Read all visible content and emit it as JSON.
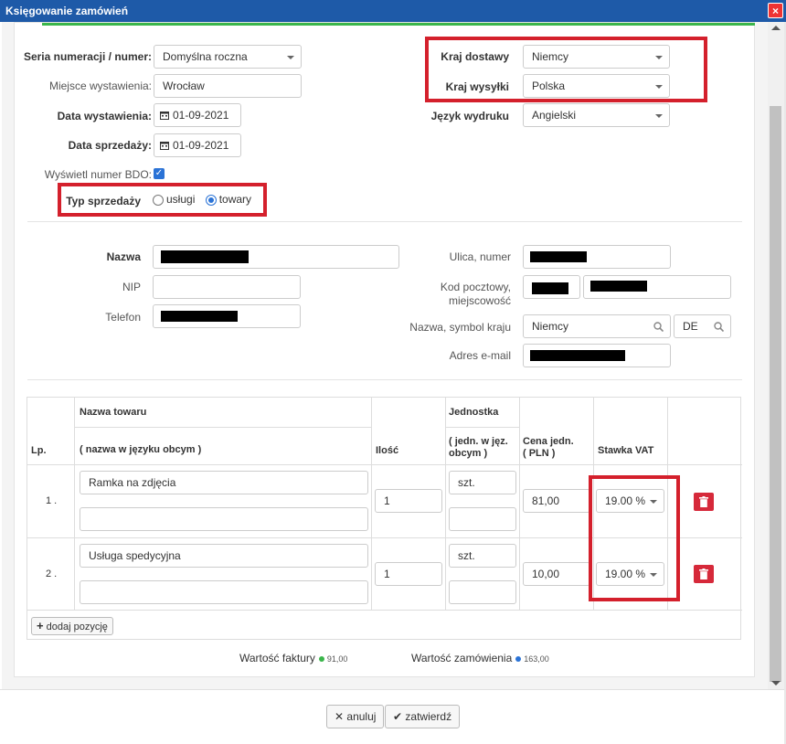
{
  "window": {
    "title": "Księgowanie zamówień",
    "close": "×"
  },
  "header": {
    "series_label": "Seria numeracji / numer:",
    "series_value": "Domyślna roczna",
    "place_label": "Miejsce wystawienia:",
    "place_value": "Wrocław",
    "issue_date_label": "Data wystawienia:",
    "issue_date_value": "01-09-2021",
    "sale_date_label": "Data sprzedaży:",
    "sale_date_value": "01-09-2021",
    "bdo_label": "Wyświetl numer BDO:",
    "bdo_checked": true,
    "sale_type_label": "Typ sprzedaży",
    "sale_type_options": [
      "usługi",
      "towary"
    ],
    "sale_type_selected": "towary",
    "delivery_country_label": "Kraj dostawy",
    "delivery_country_value": "Niemcy",
    "shipping_country_label": "Kraj wysyłki",
    "shipping_country_value": "Polska",
    "print_language_label": "Język wydruku",
    "print_language_value": "Angielski"
  },
  "buyer": {
    "name_label": "Nazwa",
    "nip_label": "NIP",
    "phone_label": "Telefon",
    "street_label": "Ulica, numer",
    "postal_label_1": "Kod pocztowy,",
    "postal_label_2": "miejscowość",
    "country_label": "Nazwa, symbol kraju",
    "country_value": "Niemcy",
    "country_code": "DE",
    "email_label": "Adres e-mail"
  },
  "table": {
    "col_lp": "Lp.",
    "col_name": "Nazwa towaru",
    "col_name_foreign": "( nazwa w języku obcym )",
    "col_qty": "Ilość",
    "col_unit": "Jednostka",
    "col_unit_foreign_1": "( jedn. w jęz.",
    "col_unit_foreign_2": "obcym )",
    "col_price_1": "Cena jedn.",
    "col_price_2": "( PLN )",
    "col_vat": "Stawka VAT",
    "rows": [
      {
        "lp": "1 .",
        "name": "Ramka na zdjęcia",
        "name_foreign": "",
        "qty": "1",
        "unit": "szt.",
        "unit_foreign": "",
        "price": "81,00",
        "vat": "19.00 %"
      },
      {
        "lp": "2 .",
        "name": "Usługa spedycyjna",
        "name_foreign": "",
        "qty": "1",
        "unit": "szt.",
        "unit_foreign": "",
        "price": "10,00",
        "vat": "19.00 %"
      }
    ],
    "add_label": "dodaj pozycję"
  },
  "summary": {
    "invoice_label": "Wartość faktury",
    "invoice_value": "91,00",
    "invoice_color": "#3ab54a",
    "order_label": "Wartość zamówienia",
    "order_value": "163,00",
    "order_color": "#2b73d6"
  },
  "footer": {
    "cancel_label": "anuluj",
    "confirm_label": "zatwierdź"
  },
  "colors": {
    "titlebar": "#1e5aa8",
    "highlight": "#d4202c",
    "delete": "#d6293a"
  }
}
